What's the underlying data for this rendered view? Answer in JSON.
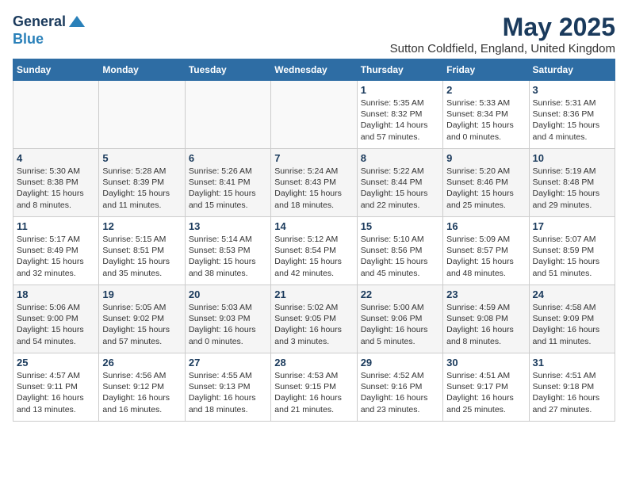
{
  "header": {
    "logo_line1": "General",
    "logo_line2": "Blue",
    "month_title": "May 2025",
    "subtitle": "Sutton Coldfield, England, United Kingdom"
  },
  "weekdays": [
    "Sunday",
    "Monday",
    "Tuesday",
    "Wednesday",
    "Thursday",
    "Friday",
    "Saturday"
  ],
  "weeks": [
    [
      {
        "day": "",
        "info": ""
      },
      {
        "day": "",
        "info": ""
      },
      {
        "day": "",
        "info": ""
      },
      {
        "day": "",
        "info": ""
      },
      {
        "day": "1",
        "info": "Sunrise: 5:35 AM\nSunset: 8:32 PM\nDaylight: 14 hours\nand 57 minutes."
      },
      {
        "day": "2",
        "info": "Sunrise: 5:33 AM\nSunset: 8:34 PM\nDaylight: 15 hours\nand 0 minutes."
      },
      {
        "day": "3",
        "info": "Sunrise: 5:31 AM\nSunset: 8:36 PM\nDaylight: 15 hours\nand 4 minutes."
      }
    ],
    [
      {
        "day": "4",
        "info": "Sunrise: 5:30 AM\nSunset: 8:38 PM\nDaylight: 15 hours\nand 8 minutes."
      },
      {
        "day": "5",
        "info": "Sunrise: 5:28 AM\nSunset: 8:39 PM\nDaylight: 15 hours\nand 11 minutes."
      },
      {
        "day": "6",
        "info": "Sunrise: 5:26 AM\nSunset: 8:41 PM\nDaylight: 15 hours\nand 15 minutes."
      },
      {
        "day": "7",
        "info": "Sunrise: 5:24 AM\nSunset: 8:43 PM\nDaylight: 15 hours\nand 18 minutes."
      },
      {
        "day": "8",
        "info": "Sunrise: 5:22 AM\nSunset: 8:44 PM\nDaylight: 15 hours\nand 22 minutes."
      },
      {
        "day": "9",
        "info": "Sunrise: 5:20 AM\nSunset: 8:46 PM\nDaylight: 15 hours\nand 25 minutes."
      },
      {
        "day": "10",
        "info": "Sunrise: 5:19 AM\nSunset: 8:48 PM\nDaylight: 15 hours\nand 29 minutes."
      }
    ],
    [
      {
        "day": "11",
        "info": "Sunrise: 5:17 AM\nSunset: 8:49 PM\nDaylight: 15 hours\nand 32 minutes."
      },
      {
        "day": "12",
        "info": "Sunrise: 5:15 AM\nSunset: 8:51 PM\nDaylight: 15 hours\nand 35 minutes."
      },
      {
        "day": "13",
        "info": "Sunrise: 5:14 AM\nSunset: 8:53 PM\nDaylight: 15 hours\nand 38 minutes."
      },
      {
        "day": "14",
        "info": "Sunrise: 5:12 AM\nSunset: 8:54 PM\nDaylight: 15 hours\nand 42 minutes."
      },
      {
        "day": "15",
        "info": "Sunrise: 5:10 AM\nSunset: 8:56 PM\nDaylight: 15 hours\nand 45 minutes."
      },
      {
        "day": "16",
        "info": "Sunrise: 5:09 AM\nSunset: 8:57 PM\nDaylight: 15 hours\nand 48 minutes."
      },
      {
        "day": "17",
        "info": "Sunrise: 5:07 AM\nSunset: 8:59 PM\nDaylight: 15 hours\nand 51 minutes."
      }
    ],
    [
      {
        "day": "18",
        "info": "Sunrise: 5:06 AM\nSunset: 9:00 PM\nDaylight: 15 hours\nand 54 minutes."
      },
      {
        "day": "19",
        "info": "Sunrise: 5:05 AM\nSunset: 9:02 PM\nDaylight: 15 hours\nand 57 minutes."
      },
      {
        "day": "20",
        "info": "Sunrise: 5:03 AM\nSunset: 9:03 PM\nDaylight: 16 hours\nand 0 minutes."
      },
      {
        "day": "21",
        "info": "Sunrise: 5:02 AM\nSunset: 9:05 PM\nDaylight: 16 hours\nand 3 minutes."
      },
      {
        "day": "22",
        "info": "Sunrise: 5:00 AM\nSunset: 9:06 PM\nDaylight: 16 hours\nand 5 minutes."
      },
      {
        "day": "23",
        "info": "Sunrise: 4:59 AM\nSunset: 9:08 PM\nDaylight: 16 hours\nand 8 minutes."
      },
      {
        "day": "24",
        "info": "Sunrise: 4:58 AM\nSunset: 9:09 PM\nDaylight: 16 hours\nand 11 minutes."
      }
    ],
    [
      {
        "day": "25",
        "info": "Sunrise: 4:57 AM\nSunset: 9:11 PM\nDaylight: 16 hours\nand 13 minutes."
      },
      {
        "day": "26",
        "info": "Sunrise: 4:56 AM\nSunset: 9:12 PM\nDaylight: 16 hours\nand 16 minutes."
      },
      {
        "day": "27",
        "info": "Sunrise: 4:55 AM\nSunset: 9:13 PM\nDaylight: 16 hours\nand 18 minutes."
      },
      {
        "day": "28",
        "info": "Sunrise: 4:53 AM\nSunset: 9:15 PM\nDaylight: 16 hours\nand 21 minutes."
      },
      {
        "day": "29",
        "info": "Sunrise: 4:52 AM\nSunset: 9:16 PM\nDaylight: 16 hours\nand 23 minutes."
      },
      {
        "day": "30",
        "info": "Sunrise: 4:51 AM\nSunset: 9:17 PM\nDaylight: 16 hours\nand 25 minutes."
      },
      {
        "day": "31",
        "info": "Sunrise: 4:51 AM\nSunset: 9:18 PM\nDaylight: 16 hours\nand 27 minutes."
      }
    ]
  ]
}
